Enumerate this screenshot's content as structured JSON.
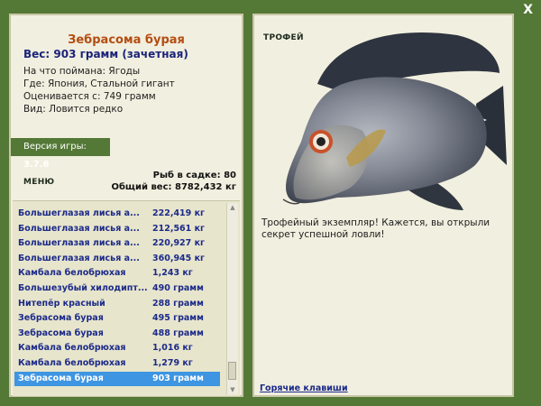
{
  "window": {
    "close_label": "X"
  },
  "fish": {
    "name": "Зебрасома бурая",
    "weight_line": "Вес: 903 грамм (зачетная)",
    "info": [
      "На что поймана: Ягоды",
      "Где: Япония, Стальной гигант",
      "Оценивается с: 749 грамм",
      "Вид: Ловится редко"
    ]
  },
  "version": {
    "label": "Версия игры:",
    "value": "3.7.6"
  },
  "menu": {
    "label": "МЕНЮ"
  },
  "stats": {
    "count": "Рыб в садке: 80",
    "total": "Общий вес: 8782,432 кг"
  },
  "catches": [
    {
      "name": "Большеглазая лисья а...",
      "weight": "222,419 кг"
    },
    {
      "name": "Большеглазая лисья а...",
      "weight": "212,561 кг"
    },
    {
      "name": "Большеглазая лисья а...",
      "weight": "220,927 кг"
    },
    {
      "name": "Большеглазая лисья а...",
      "weight": "360,945 кг"
    },
    {
      "name": "Камбала белобрюхая",
      "weight": "1,243 кг"
    },
    {
      "name": "Большезубый хилодипт...",
      "weight": "490 грамм"
    },
    {
      "name": "Нитепёр красный",
      "weight": "288 грамм"
    },
    {
      "name": "Зебрасома бурая",
      "weight": "495 грамм"
    },
    {
      "name": "Зебрасома бурая",
      "weight": "488 грамм"
    },
    {
      "name": "Камбала белобрюхая",
      "weight": "1,016 кг"
    },
    {
      "name": "Камбала белобрюхая",
      "weight": "1,279 кг"
    },
    {
      "name": "Зебрасома бурая",
      "weight": "903 грамм"
    }
  ],
  "selected_index": 11,
  "trophy": {
    "label": "ТРОФЕЙ",
    "text": "Трофейный экземпляр! Кажется, вы открыли секрет успешной ловли!"
  },
  "hotkeys": {
    "label": "Горячие клавиши"
  },
  "colors": {
    "background": "#547836",
    "panel": "#f1efdf",
    "title": "#b54d12",
    "list_text": "#1c2a8a",
    "selection": "#3e95e2"
  }
}
